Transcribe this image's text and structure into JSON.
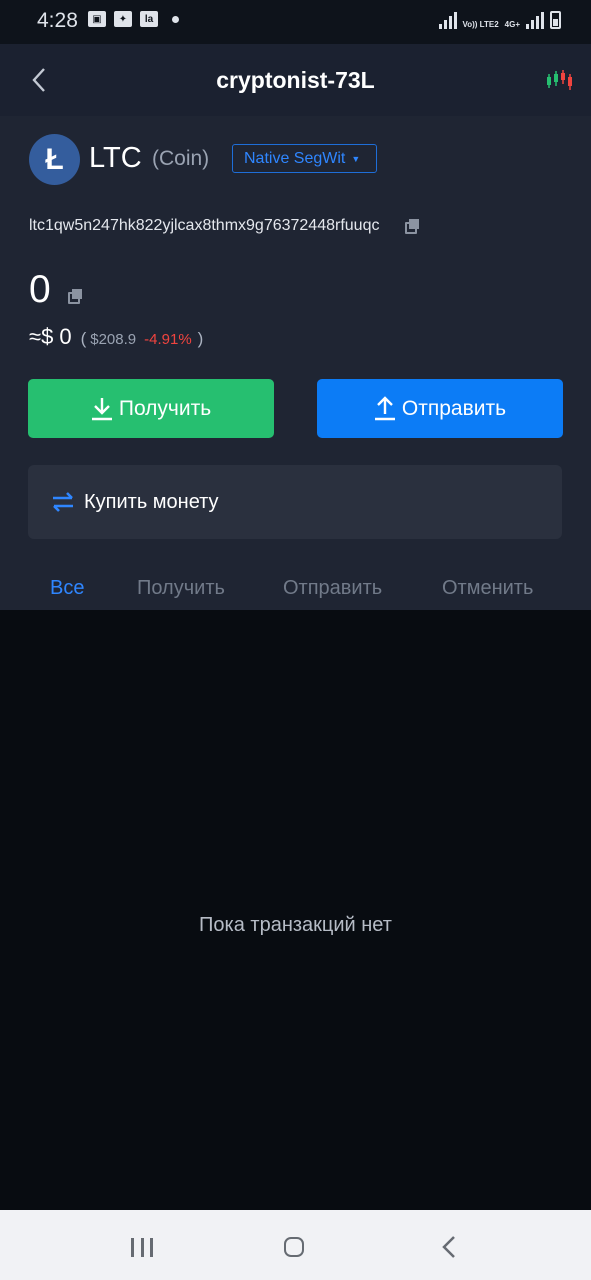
{
  "status_bar": {
    "time": "4:28",
    "notification_icons": [
      "image-icon",
      "bird-app-icon",
      "la-app-icon"
    ],
    "network_line1": "Vo)) LTE2",
    "network_line2": "4G+"
  },
  "header": {
    "title": "cryptonist-73L",
    "back_icon": "chevron-left-icon",
    "chart_icon": "candlestick-chart-icon"
  },
  "coin": {
    "ticker": "LTC",
    "type": "(Coin)",
    "address_type": "Native SegWit",
    "address": "ltc1qw5n247hk822yjlcax8thmx9g76372448rfuuqc"
  },
  "balance": {
    "amount": "0",
    "fiat_prefix": "≈$",
    "fiat_value": "0",
    "open_paren": "(",
    "price": "$208.9",
    "change": "-4.91%",
    "close_paren": ")"
  },
  "actions": {
    "receive_label": "Получить",
    "send_label": "Отправить",
    "buy_label": "Купить монету"
  },
  "tabs": [
    "Все",
    "Получить",
    "Отправить",
    "Отменить"
  ],
  "empty_state": "Пока транзакций нет",
  "colors": {
    "receive": "#26bf70",
    "send": "#0c7cf6",
    "accent": "#2f86ff",
    "negative": "#f0443f"
  }
}
